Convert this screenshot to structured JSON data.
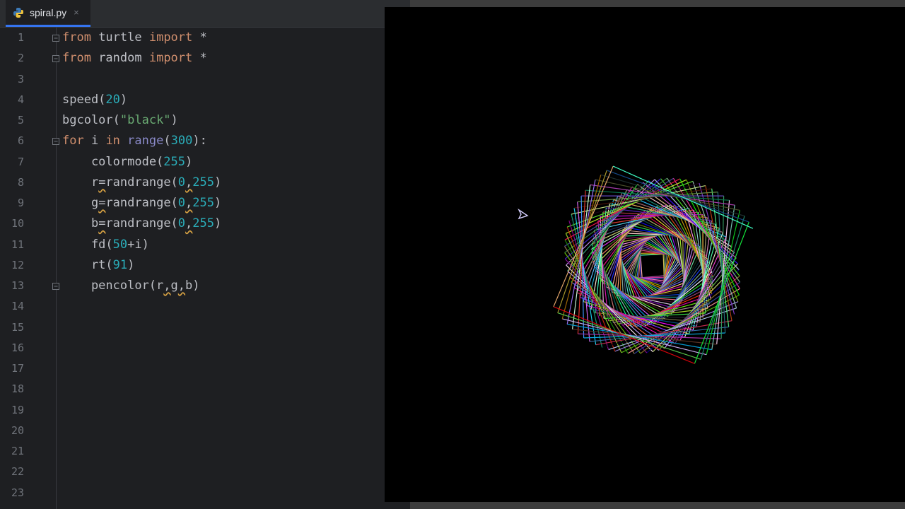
{
  "editor": {
    "tab": {
      "filename": "spiral.py",
      "close_glyph": "×"
    },
    "line_numbers": [
      "1",
      "2",
      "3",
      "4",
      "5",
      "6",
      "7",
      "8",
      "9",
      "10",
      "11",
      "12",
      "13",
      "14",
      "15",
      "16",
      "17",
      "18",
      "19",
      "20",
      "21",
      "22",
      "23"
    ],
    "code": [
      [
        {
          "t": "from",
          "c": "kw"
        },
        {
          "t": " turtle ",
          "c": ""
        },
        {
          "t": "import",
          "c": "kw"
        },
        {
          "t": " *",
          "c": ""
        }
      ],
      [
        {
          "t": "from",
          "c": "kw"
        },
        {
          "t": " random ",
          "c": ""
        },
        {
          "t": "import",
          "c": "kw"
        },
        {
          "t": " *",
          "c": ""
        }
      ],
      [],
      [
        {
          "t": "speed(",
          "c": ""
        },
        {
          "t": "20",
          "c": "num"
        },
        {
          "t": ")",
          "c": ""
        }
      ],
      [
        {
          "t": "bgcolor(",
          "c": ""
        },
        {
          "t": "\"black\"",
          "c": "str"
        },
        {
          "t": ")",
          "c": ""
        }
      ],
      [
        {
          "t": "for",
          "c": "kw"
        },
        {
          "t": " i ",
          "c": ""
        },
        {
          "t": "in",
          "c": "kw"
        },
        {
          "t": " ",
          "c": ""
        },
        {
          "t": "range",
          "c": "bi"
        },
        {
          "t": "(",
          "c": ""
        },
        {
          "t": "300",
          "c": "num"
        },
        {
          "t": "):",
          "c": ""
        }
      ],
      [
        {
          "t": "    colormode(",
          "c": ""
        },
        {
          "t": "255",
          "c": "num"
        },
        {
          "t": ")",
          "c": ""
        }
      ],
      [
        {
          "t": "    r",
          "c": ""
        },
        {
          "t": "=",
          "c": "warn"
        },
        {
          "t": "randrange(",
          "c": ""
        },
        {
          "t": "0",
          "c": "num"
        },
        {
          "t": ",",
          "c": "warn"
        },
        {
          "t": "255",
          "c": "num"
        },
        {
          "t": ")",
          "c": ""
        }
      ],
      [
        {
          "t": "    g",
          "c": ""
        },
        {
          "t": "=",
          "c": "warn"
        },
        {
          "t": "randrange(",
          "c": ""
        },
        {
          "t": "0",
          "c": "num"
        },
        {
          "t": ",",
          "c": "warn"
        },
        {
          "t": "255",
          "c": "num"
        },
        {
          "t": ")",
          "c": ""
        }
      ],
      [
        {
          "t": "    b",
          "c": ""
        },
        {
          "t": "=",
          "c": "warn"
        },
        {
          "t": "randrange(",
          "c": ""
        },
        {
          "t": "0",
          "c": "num"
        },
        {
          "t": ",",
          "c": "warn"
        },
        {
          "t": "255",
          "c": "num"
        },
        {
          "t": ")",
          "c": ""
        }
      ],
      [
        {
          "t": "    fd(",
          "c": ""
        },
        {
          "t": "50",
          "c": "num"
        },
        {
          "t": "+i)",
          "c": ""
        }
      ],
      [
        {
          "t": "    rt(",
          "c": ""
        },
        {
          "t": "91",
          "c": "num"
        },
        {
          "t": ")",
          "c": ""
        }
      ],
      [
        {
          "t": "    pencolor(r",
          "c": ""
        },
        {
          "t": ",",
          "c": "warn"
        },
        {
          "t": "g",
          "c": ""
        },
        {
          "t": ",",
          "c": "warn"
        },
        {
          "t": "b)",
          "c": ""
        }
      ]
    ],
    "fold_lines": [
      1,
      2,
      6,
      13
    ],
    "colors": {
      "keyword": "#cf8e6d",
      "number": "#2aacb8",
      "string": "#6aab73",
      "builtin": "#8888c6",
      "text": "#bcbec4",
      "background": "#1e1f22"
    }
  },
  "turtle": {
    "background": "black",
    "speed": 20,
    "iterations": 300,
    "base_length": 50,
    "turn_degrees": 91,
    "icons": [
      "python-file-icon",
      "turtle-arrow-icon",
      "fold-marker-icon"
    ]
  }
}
